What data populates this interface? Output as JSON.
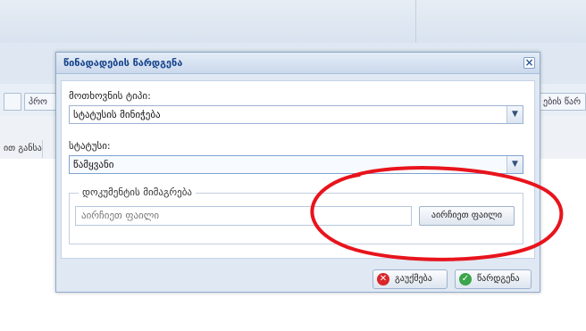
{
  "background": {
    "tabs": [
      "",
      "პრო",
      "ების წარ"
    ],
    "subtab": "ით განსა"
  },
  "dialog": {
    "title": "წინადადების წარდგენა",
    "close_glyph": "×",
    "request_type": {
      "label": "მოთხოვნის ტიპი:",
      "value": "სტატუსის მინიჭება"
    },
    "status": {
      "label": "სტატუსი:",
      "value": "წამყვანი"
    },
    "attachment": {
      "legend": "დოკუმენტის მიმაგრება",
      "placeholder": "აირჩიეთ ფაილი",
      "button_label": "აირჩიეთ ფაილი"
    },
    "buttons": {
      "cancel_label": "გაუქმება",
      "submit_label": "წარდგენა"
    }
  },
  "icons": {
    "cancel": "x-circle-icon",
    "submit": "check-circle-icon",
    "dropdown": "chevron-down-icon"
  },
  "colors": {
    "accent": "#15428b",
    "annotation": "#e8141c",
    "cancel": "#d8262b",
    "ok": "#3aa54a"
  }
}
